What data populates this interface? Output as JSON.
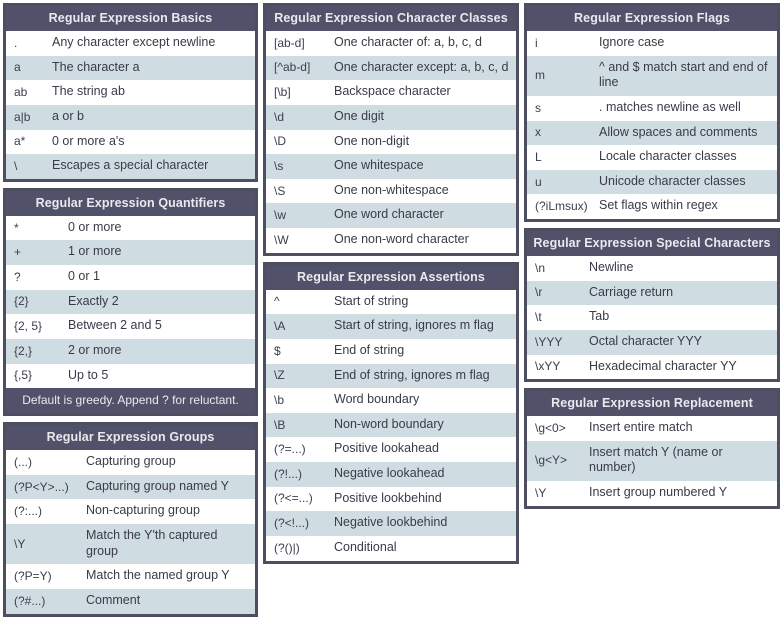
{
  "tables": {
    "basics": {
      "title": "Regular Expression Basics",
      "rows": [
        {
          "code": ".",
          "desc": "Any character except newline"
        },
        {
          "code": "a",
          "desc": "The character a"
        },
        {
          "code": "ab",
          "desc": "The string ab"
        },
        {
          "code": "a|b",
          "desc": "a or b"
        },
        {
          "code": "a*",
          "desc": "0 or more a's"
        },
        {
          "code": "\\",
          "desc": "Escapes a special character"
        }
      ]
    },
    "quantifiers": {
      "title": "Regular Expression Quantifiers",
      "footer": "Default is greedy. Append ? for reluctant.",
      "rows": [
        {
          "code": "*",
          "desc": "0 or more"
        },
        {
          "code": "+",
          "desc": "1 or more"
        },
        {
          "code": "?",
          "desc": "0 or 1"
        },
        {
          "code": "{2}",
          "desc": "Exactly 2"
        },
        {
          "code": "{2, 5}",
          "desc": "Between 2 and 5"
        },
        {
          "code": "{2,}",
          "desc": "2 or more"
        },
        {
          "code": "{,5}",
          "desc": "Up to 5"
        }
      ]
    },
    "groups": {
      "title": "Regular Expression Groups",
      "rows": [
        {
          "code": "(...)",
          "desc": "Capturing group"
        },
        {
          "code": "(?P<Y>...)",
          "desc": "Capturing group named Y"
        },
        {
          "code": "(?:...)",
          "desc": "Non-capturing group"
        },
        {
          "code": "\\Y",
          "desc": "Match the Y'th captured group"
        },
        {
          "code": "(?P=Y)",
          "desc": "Match the named group Y"
        },
        {
          "code": "(?#...)",
          "desc": "Comment"
        }
      ]
    },
    "character_classes": {
      "title": "Regular Expression Character Classes",
      "rows": [
        {
          "code": "[ab-d]",
          "desc": "One character of: a, b, c, d"
        },
        {
          "code": "[^ab-d]",
          "desc": "One character except: a, b, c, d"
        },
        {
          "code": "[\\b]",
          "desc": "Backspace character"
        },
        {
          "code": "\\d",
          "desc": "One digit"
        },
        {
          "code": "\\D",
          "desc": "One non-digit"
        },
        {
          "code": "\\s",
          "desc": "One whitespace"
        },
        {
          "code": "\\S",
          "desc": "One non-whitespace"
        },
        {
          "code": "\\w",
          "desc": "One word character"
        },
        {
          "code": "\\W",
          "desc": "One non-word character"
        }
      ]
    },
    "assertions": {
      "title": "Regular Expression Assertions",
      "rows": [
        {
          "code": "^",
          "desc": "Start of string"
        },
        {
          "code": "\\A",
          "desc": "Start of string, ignores m flag"
        },
        {
          "code": "$",
          "desc": "End of string"
        },
        {
          "code": "\\Z",
          "desc": "End of string, ignores m flag"
        },
        {
          "code": "\\b",
          "desc": "Word boundary"
        },
        {
          "code": "\\B",
          "desc": "Non-word boundary"
        },
        {
          "code": "(?=...)",
          "desc": "Positive lookahead"
        },
        {
          "code": "(?!...)",
          "desc": "Negative lookahead"
        },
        {
          "code": "(?<=...)",
          "desc": "Positive lookbehind"
        },
        {
          "code": "(?<!...)",
          "desc": "Negative lookbehind"
        },
        {
          "code": "(?()|)",
          "desc": "Conditional"
        }
      ]
    },
    "flags": {
      "title": "Regular Expression Flags",
      "rows": [
        {
          "code": "i",
          "desc": "Ignore case"
        },
        {
          "code": "m",
          "desc": "^ and $ match start and end of line"
        },
        {
          "code": "s",
          "desc": ". matches newline as well"
        },
        {
          "code": "x",
          "desc": "Allow spaces and comments"
        },
        {
          "code": "L",
          "desc": "Locale character classes"
        },
        {
          "code": "u",
          "desc": "Unicode character classes"
        },
        {
          "code": "(?iLmsux)",
          "desc": "Set flags within regex"
        }
      ]
    },
    "special_characters": {
      "title": "Regular Expression Special Characters",
      "rows": [
        {
          "code": "\\n",
          "desc": "Newline"
        },
        {
          "code": "\\r",
          "desc": "Carriage return"
        },
        {
          "code": "\\t",
          "desc": "Tab"
        },
        {
          "code": "\\YYY",
          "desc": "Octal character YYY"
        },
        {
          "code": "\\xYY",
          "desc": "Hexadecimal character YY"
        }
      ]
    },
    "replacement": {
      "title": "Regular Expression Replacement",
      "rows": [
        {
          "code": "\\g<0>",
          "desc": "Insert entire match"
        },
        {
          "code": "\\g<Y>",
          "desc": "Insert match Y (name or number)"
        },
        {
          "code": "\\Y",
          "desc": "Insert group numbered Y"
        }
      ]
    }
  },
  "colors": {
    "header_bg": "#51516a",
    "border": "#4e4e61",
    "row_alt_bg": "#cfdde2",
    "row_bg": "#ffffff",
    "text": "#3a3a48",
    "header_text": "#e9e9ef"
  }
}
